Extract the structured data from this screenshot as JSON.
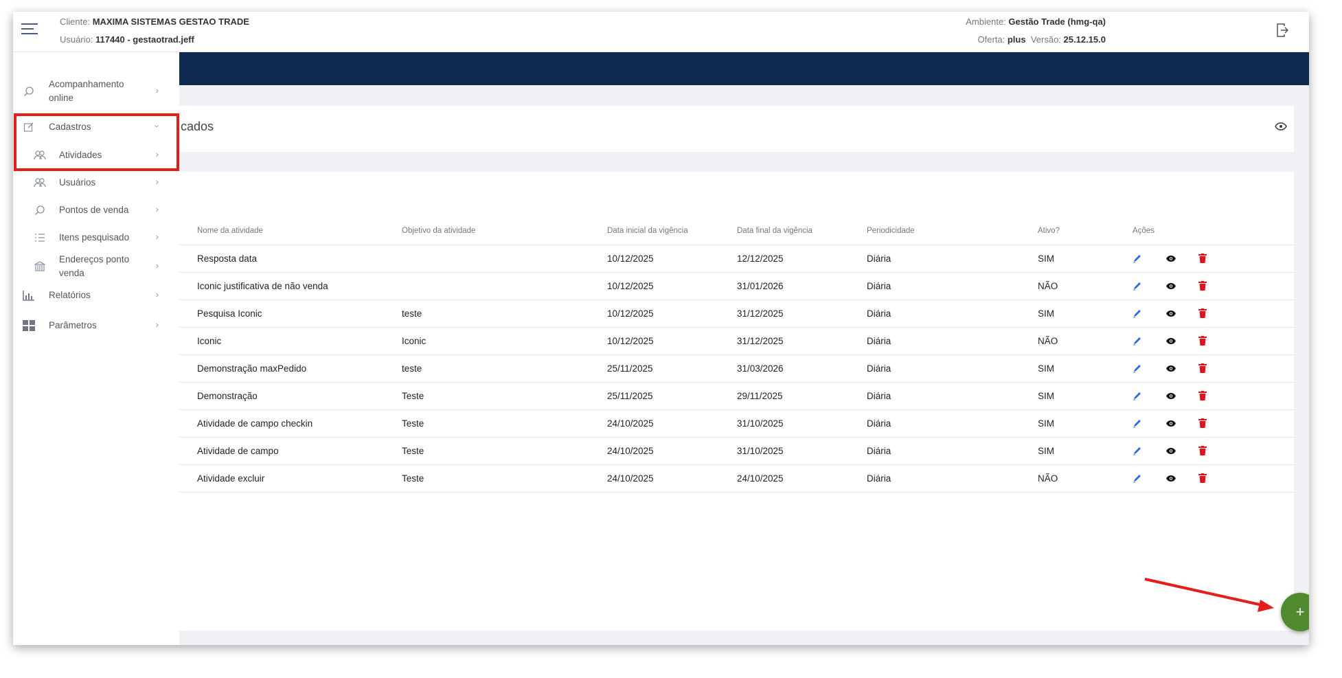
{
  "header": {
    "client_label": "Cliente:",
    "client_value": "MAXIMA SISTEMAS GESTAO TRADE",
    "user_label": "Usuário:",
    "user_value": "117440 - gestaotrad.jeff",
    "env_label": "Ambiente:",
    "env_value": "Gestão Trade (hmg-qa)",
    "offer_label": "Oferta:",
    "offer_value": "plus",
    "version_label": "Versão:",
    "version_value": "25.12.15.0"
  },
  "sidebar": {
    "items": [
      {
        "label": "Acompanhamento online",
        "icon": "search-icon"
      },
      {
        "label": "Cadastros",
        "icon": "edit-icon"
      },
      {
        "label": "Atividades",
        "icon": "users-icon"
      },
      {
        "label": "Usuários",
        "icon": "users-icon"
      },
      {
        "label": "Pontos de venda",
        "icon": "search-icon"
      },
      {
        "label": "Itens pesquisado",
        "icon": "list-icon"
      },
      {
        "label": "Endereços ponto venda",
        "icon": "bank-icon"
      },
      {
        "label": "Relatórios",
        "icon": "chart-icon"
      },
      {
        "label": "Parâmetros",
        "icon": "grid-icon"
      }
    ]
  },
  "card_title": "cados",
  "table": {
    "headers": [
      "Nome da atividade",
      "Objetivo da atividade",
      "Data inicial da vigência",
      "Data final da vigência",
      "Periodicidade",
      "Ativo?",
      "Ações"
    ],
    "rows": [
      [
        "Resposta data",
        "",
        "10/12/2025",
        "12/12/2025",
        "Diária",
        "SIM"
      ],
      [
        "Iconic justificativa de não venda",
        "",
        "10/12/2025",
        "31/01/2026",
        "Diária",
        "NÃO"
      ],
      [
        "Pesquisa Iconic",
        "teste",
        "10/12/2025",
        "31/12/2025",
        "Diária",
        "SIM"
      ],
      [
        "Iconic",
        "Iconic",
        "10/12/2025",
        "31/12/2025",
        "Diária",
        "NÃO"
      ],
      [
        "Demonstração maxPedido",
        "teste",
        "25/11/2025",
        "31/03/2026",
        "Diária",
        "SIM"
      ],
      [
        "Demonstração",
        "Teste",
        "25/11/2025",
        "29/11/2025",
        "Diária",
        "SIM"
      ],
      [
        "Atividade de campo checkin",
        "Teste",
        "24/10/2025",
        "31/10/2025",
        "Diária",
        "SIM"
      ],
      [
        "Atividade de campo",
        "Teste",
        "24/10/2025",
        "31/10/2025",
        "Diária",
        "SIM"
      ],
      [
        "Atividade excluir",
        "Teste",
        "24/10/2025",
        "24/10/2025",
        "Diária",
        "NÃO"
      ]
    ]
  },
  "fab_label": "+",
  "colors": {
    "banner": "#0f2a4e",
    "fab": "#4f8a2e",
    "highlight": "#e41d1d",
    "edit": "#2f6fd6",
    "delete": "#e0141e"
  }
}
